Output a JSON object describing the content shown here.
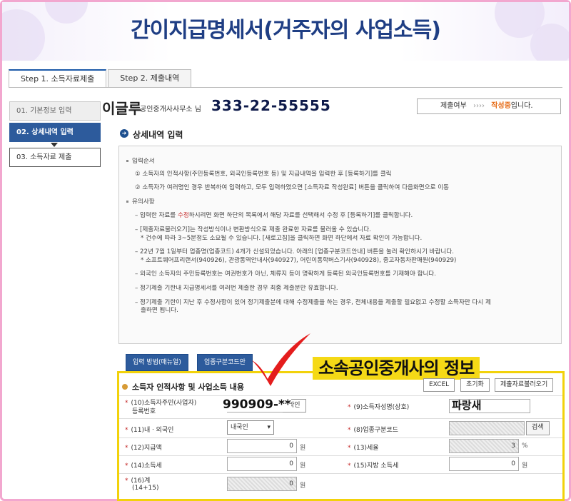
{
  "banner": {
    "title": "간이지급명세서(거주자의 사업소득)"
  },
  "tabs": [
    {
      "label": "Step 1. 소득자료제출",
      "active": true
    },
    {
      "label": "Step 2. 제출내역",
      "active": false
    }
  ],
  "side_steps": [
    {
      "label": "01. 기본정보 입력"
    },
    {
      "label": "02. 상세내역 입력"
    },
    {
      "label": "03. 소득자료 제출"
    }
  ],
  "header": {
    "name": "이글루",
    "office": "공인중개사사무소 님",
    "reg_no": "333-22-55555",
    "status_label": "제출여부",
    "status_arrows": "››››",
    "status_value": "작성중",
    "status_suffix": "입니다."
  },
  "section": {
    "icon": "arrow-circle-icon",
    "title": "상세내역 입력"
  },
  "instructions": {
    "order_title": "입력순서",
    "order_1": "① 소득자의 인적사항(주민등록번호, 외국인등록번호 등) 및 지급내역을 입력한 후 [등록하기]를 클릭",
    "order_2": "② 소득자가 여러명인 경우 반복하여 입력하고, 모두 입력하였으면 [소득자료 작성완료] 버튼을 클릭하여 다음화면으로 이동",
    "notes_title": "유의사항",
    "note_1a": "– 입력한 자료를 ",
    "note_1_red": "수정",
    "note_1b": "하시려면 화면 하단의 목록에서 해당 자료를 선택해서 수정 후 [등록하기]를 클릭합니다.",
    "note_2": "– [제출자료불러오기]는 작성방식이나 변환방식으로 제출 완료한 자료를 불러올 수 있습니다.",
    "note_2b": "* 건수에 따라 3~5분정도 소요될 수 있습니다. [새로고침]을 클릭하면 화면 하단에서 자료 확인이 가능합니다.",
    "note_3": "– 22년 7월 1일부터 업종명(업종코드) 4개가 신설되었습니다. 아래의 [업종구분코드안내] 버튼을 눌러 확인하시기 바랍니다.",
    "note_3b": "* 소프트웨어프리랜서(940926), 관광통역안내사(940927), 어린이통학버스기사(940928), 중고자동차판매원(940929)",
    "note_4": "– 외국인 소득자의 주민등록번호는 여권번호가 아닌, 체류지 등이 명확하게 등록된 외국인등록번호를 기재해야 합니다.",
    "note_5": "– 정기제출 기한내 지급명세서를 여러번 제출한 경우 최종 제출분만 유효합니다.",
    "note_6": "– 정기제출 기한이 지난 후 수정사항이 있어 정기제출분에 대해 수정제출을 하는 경우, 전체내용을 제출할 필요없고 수정할 소득자만 다시 제",
    "note_6b": "출하면 됩니다."
  },
  "buttons": {
    "input_method": "입력 방법(매뉴얼)",
    "industry_code": "업종구분코드안",
    "excel": "EXCEL",
    "reset": "초기화",
    "load": "제출자료불러오기",
    "confirm": "확인",
    "search": "검색"
  },
  "overlay": {
    "title": "소속공인중개사의 정보"
  },
  "form": {
    "title": "소득자 인적사항 및 사업소득 내용",
    "f10_label_1": "(10)소득자주민(사업자)",
    "f10_label_2": "등록번호",
    "f10_value": "990909-**",
    "f9_label": "(9)소득자성명(상호)",
    "f9_value": "파랑새",
    "f11_label": "(11)내ㆍ외국인",
    "f11_value": "내국인",
    "f8_label": "(8)업종구분코드",
    "f12_label": "(12)지급액",
    "f12_value": "0",
    "f13_label": "(13)세율",
    "f13_value": "3",
    "f14_label": "(14)소득세",
    "f14_value": "0",
    "f15_label": "(15)지방 소득세",
    "f15_value": "0",
    "f16_label_1": "(16)계",
    "f16_label_2": "(14+15)",
    "f16_value": "0",
    "unit_won": "원",
    "unit_pct": "%"
  },
  "colors": {
    "brand": "#1f3e84",
    "active_step": "#2d5b9c",
    "highlight": "#f5d916",
    "status": "#e66b16",
    "frame": "#f2a7cf"
  }
}
